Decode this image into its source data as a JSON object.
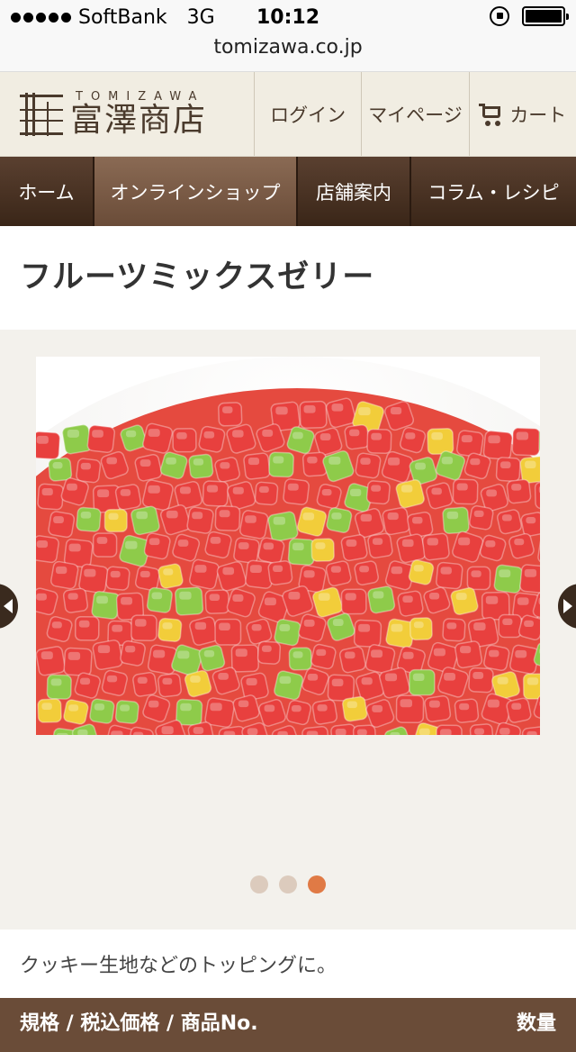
{
  "status_bar": {
    "carrier": "SoftBank",
    "network": "3G",
    "time": "10:12"
  },
  "browser": {
    "url": "tomizawa.co.jp"
  },
  "header": {
    "logo_roman": "TOMIZAWA",
    "logo_jp": "富澤商店",
    "login": "ログイン",
    "mypage": "マイページ",
    "cart": "カート"
  },
  "nav": {
    "items": [
      {
        "label": "ホーム"
      },
      {
        "label": "オンラインショップ"
      },
      {
        "label": "店舗案内"
      },
      {
        "label": "コラム・レシピ"
      }
    ],
    "active_index": 1
  },
  "product": {
    "title": "フルーツミックスゼリー",
    "description": "クッキー生地などのトッピングに。",
    "image_alt_name": "fruit-jelly-photo",
    "gallery": {
      "page_count": 3,
      "current_page": 3
    }
  },
  "table": {
    "header_left": "規格 / 税込価格 / 商品No.",
    "header_right": "数量"
  },
  "colors": {
    "nav_dark": "#3a2618",
    "accent_orange": "#e07a45",
    "header_bg": "#f1ede2",
    "jelly_red": "#e8403e",
    "jelly_green": "#8ecb4a",
    "jelly_yellow": "#f2cd3a"
  }
}
